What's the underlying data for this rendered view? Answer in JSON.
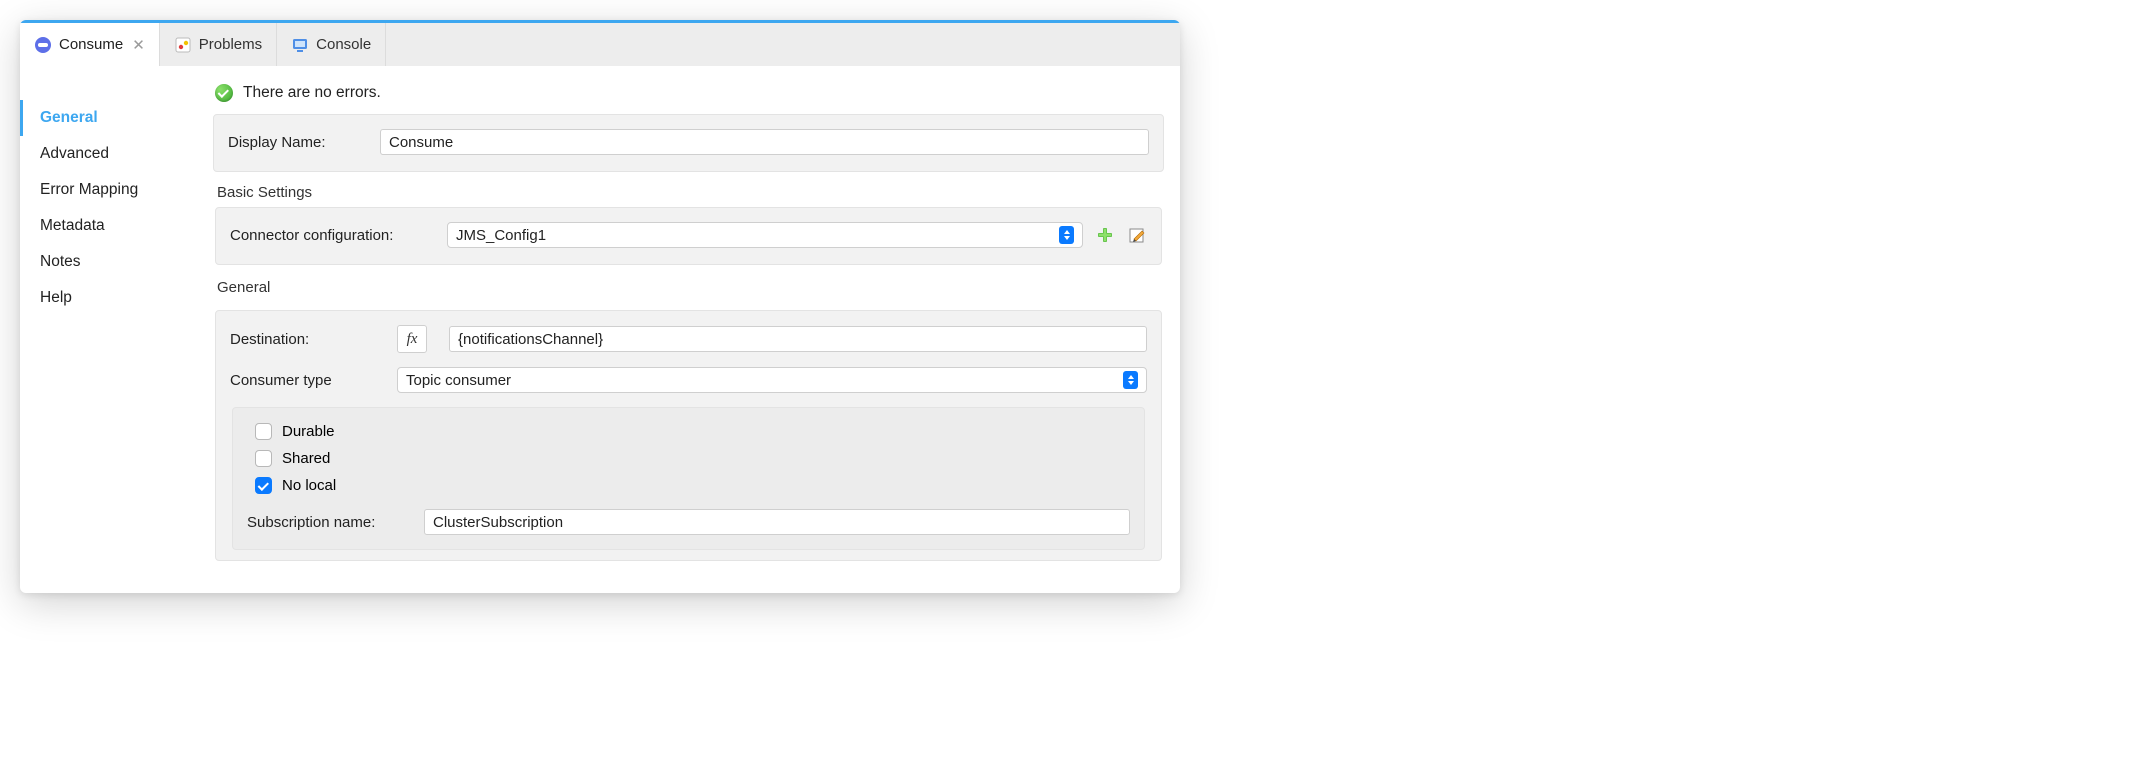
{
  "tabs": {
    "consume": "Consume",
    "problems": "Problems",
    "console": "Console"
  },
  "sidebar": {
    "items": [
      "General",
      "Advanced",
      "Error Mapping",
      "Metadata",
      "Notes",
      "Help"
    ]
  },
  "status": {
    "message": "There are no errors."
  },
  "displayName": {
    "label": "Display Name:",
    "value": "Consume"
  },
  "basicSettings": {
    "title": "Basic Settings",
    "connectorLabel": "Connector configuration:",
    "connectorValue": "JMS_Config1"
  },
  "general": {
    "title": "General",
    "destinationLabel": "Destination:",
    "destinationValue": "{notificationsChannel}",
    "consumerTypeLabel": "Consumer type",
    "consumerTypeValue": "Topic consumer",
    "checkboxes": {
      "durable": {
        "label": "Durable",
        "checked": false
      },
      "shared": {
        "label": "Shared",
        "checked": false
      },
      "noLocal": {
        "label": "No local",
        "checked": true
      }
    },
    "subscriptionLabel": "Subscription name:",
    "subscriptionValue": "ClusterSubscription"
  },
  "fx": "fx"
}
